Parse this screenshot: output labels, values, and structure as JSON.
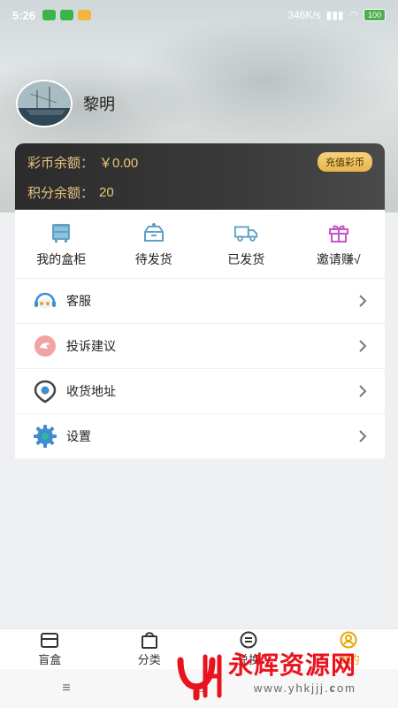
{
  "status_bar": {
    "time": "5:26",
    "network_speed": "346K/s",
    "battery": "100"
  },
  "profile": {
    "name": "黎明"
  },
  "wallet": {
    "coin_label": "彩币余额：",
    "coin_value": "￥0.00",
    "recharge_label": "充值彩币",
    "points_label": "积分余额：",
    "points_value": "20"
  },
  "quick_actions": [
    {
      "label": "我的盒柜",
      "icon": "cabinet-icon"
    },
    {
      "label": "待发货",
      "icon": "pending-box-icon"
    },
    {
      "label": "已发货",
      "icon": "truck-icon"
    },
    {
      "label": "邀请赚√",
      "icon": "gift-icon"
    }
  ],
  "menu": [
    {
      "label": "客服",
      "icon": "customer-service-icon"
    },
    {
      "label": "投诉建议",
      "icon": "complaint-icon"
    },
    {
      "label": "收货地址",
      "icon": "location-icon"
    },
    {
      "label": "设置",
      "icon": "settings-gear-icon"
    }
  ],
  "tabs": [
    {
      "label": "盲盒",
      "icon": "blind-box-icon"
    },
    {
      "label": "分类",
      "icon": "category-bag-icon"
    },
    {
      "label": "兑换",
      "icon": "exchange-icon"
    },
    {
      "label": "我的",
      "icon": "profile-icon",
      "active": true
    }
  ],
  "watermark": {
    "title": "永辉资源网",
    "url": "www.yhkjjj.com"
  },
  "colors": {
    "accent_gold": "#e6a700",
    "wallet_bg": "#2b2b2b",
    "watermark_red": "#e8131e"
  }
}
